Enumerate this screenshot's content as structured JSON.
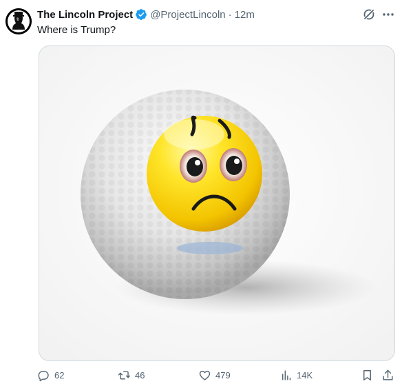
{
  "tweet": {
    "author_name": "The Lincoln Project",
    "handle": "@ProjectLincoln",
    "separator": "·",
    "time": "12m",
    "text": "Where is Trump?"
  },
  "actions": {
    "replies": "62",
    "retweets": "46",
    "likes": "479",
    "views": "14K"
  },
  "colors": {
    "verified": "#1d9bf0",
    "text_primary": "#0f1419",
    "text_secondary": "#536471",
    "border": "#cfd9de"
  },
  "icons": [
    "avatar-lincoln",
    "verified-badge-icon",
    "grok-icon",
    "more-icon",
    "reply-icon",
    "retweet-icon",
    "like-icon",
    "views-icon",
    "bookmark-icon",
    "share-icon"
  ]
}
